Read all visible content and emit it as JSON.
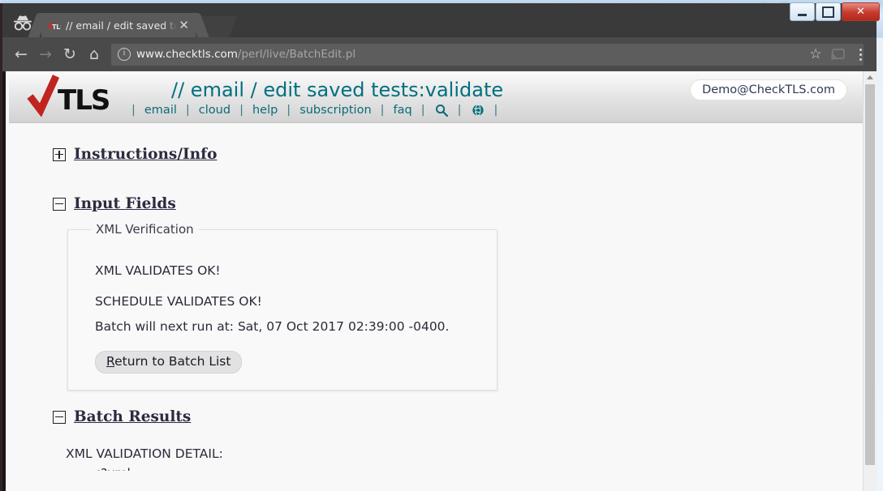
{
  "background_app": {
    "window_controls": [
      {
        "name": "minimize",
        "label": "–"
      },
      {
        "name": "maximize",
        "label": "□"
      },
      {
        "name": "close",
        "label": "✕"
      }
    ]
  },
  "browser": {
    "incognito_icon": "incognito-icon",
    "tab": {
      "favicon": "checktls-favicon",
      "title": "// email / edit saved tests",
      "close_label": "✕"
    },
    "toolbar": {
      "back_label": "←",
      "forward_label": "→",
      "reload_label": "↻",
      "home_label": "⌂",
      "site_info_label": "i",
      "url_host": "www.checktls.com",
      "url_path": "/perl/live/BatchEdit.pl",
      "bookmark_label": "☆",
      "cast_label": "cast-icon",
      "menu_label": "⋮"
    }
  },
  "site": {
    "logo_text": "TLS",
    "logo_mark": "red-check-icon",
    "page_title": "// email / edit saved tests:validate",
    "user_account": "Demo@CheckTLS.com",
    "nav": [
      {
        "id": "email",
        "label": "email",
        "type": "text"
      },
      {
        "id": "cloud",
        "label": "cloud",
        "type": "text"
      },
      {
        "id": "help",
        "label": "help",
        "type": "text"
      },
      {
        "id": "subscription",
        "label": "subscription",
        "type": "text"
      },
      {
        "id": "faq",
        "label": "faq",
        "type": "text"
      },
      {
        "id": "search",
        "label": "search-icon",
        "type": "icon"
      },
      {
        "id": "language",
        "label": "globe-icon",
        "type": "icon"
      }
    ],
    "nav_separator": "|"
  },
  "content": {
    "sections": [
      {
        "id": "instructions",
        "label": "Instructions/Info",
        "state": "collapsed",
        "toggle_icon": "plus-box-icon"
      },
      {
        "id": "input-fields",
        "label": "Input Fields",
        "state": "expanded",
        "toggle_icon": "minus-box-icon"
      },
      {
        "id": "batch-results",
        "label": "Batch Results",
        "state": "expanded",
        "toggle_icon": "minus-box-icon"
      }
    ],
    "xml_verification": {
      "legend": "XML Verification",
      "line1": "XML VALIDATES OK!",
      "line2": "SCHEDULE VALIDATES OK!",
      "line3": "Batch will next run at: Sat, 07 Oct 2017 02:39:00 -0400.",
      "button_accesskey": "R",
      "button_rest": "eturn to Batch List"
    },
    "batch_results": {
      "detail_heading": "XML VALIDATION DETAIL:",
      "detail_next_line": "<?xml"
    }
  },
  "colors": {
    "title_teal": "#00707f",
    "nav_link": "#0a6b78",
    "logo_red": "#c0241f",
    "heading_navy": "#2b2b40",
    "chrome_dark": "#4a4a4a"
  }
}
